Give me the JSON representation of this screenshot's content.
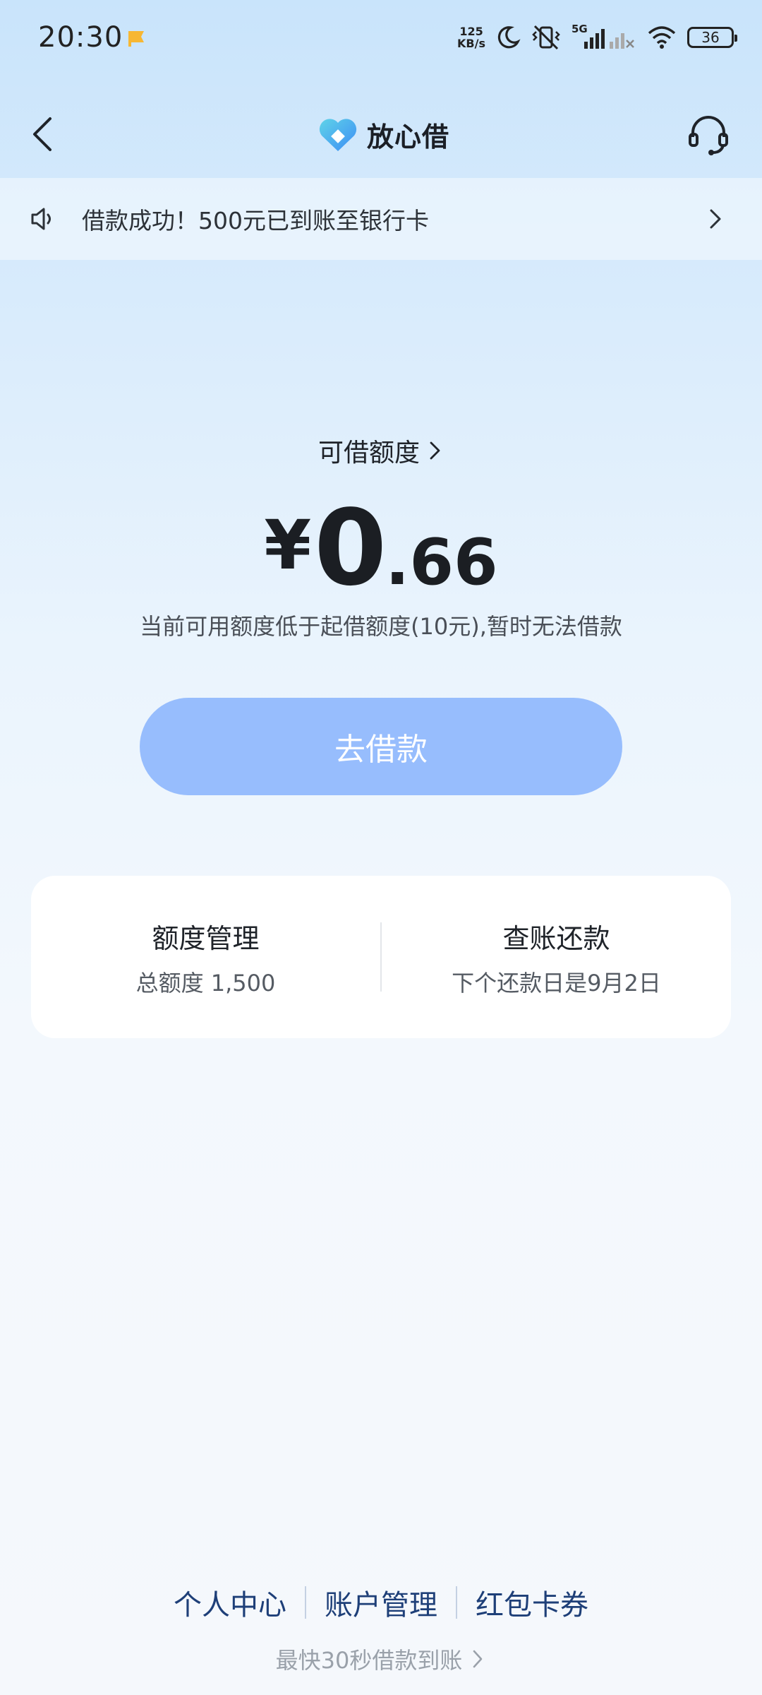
{
  "status_bar": {
    "time": "20:30",
    "net_speed_value": "125",
    "net_speed_unit": "KB/s",
    "network": "5G",
    "battery": "36",
    "icons": [
      "notification-flag-icon",
      "moon-icon",
      "vibrate-off-icon",
      "signal-icon",
      "wifi-icon",
      "battery-icon"
    ]
  },
  "nav": {
    "back_icon": "chevron-left-icon",
    "title": "放心借",
    "support_icon": "headset-icon"
  },
  "notice": {
    "icon": "speaker-icon",
    "text": "借款成功！500元已到账至银行卡",
    "arrow_icon": "chevron-right-icon"
  },
  "credit": {
    "label": "可借额度",
    "currency": "¥",
    "amount_integer": "0",
    "amount_decimal": ".66",
    "hint": "当前可用额度低于起借额度(10元),暂时无法借款",
    "button_label": "去借款"
  },
  "card": {
    "left_title": "额度管理",
    "left_sub": "总额度 1,500",
    "right_title": "查账还款",
    "right_sub": "下个还款日是9月2日"
  },
  "footer": {
    "links": [
      "个人中心",
      "账户管理",
      "红包卡券"
    ],
    "tagline": "最快30秒借款到账"
  },
  "colors": {
    "button": "#97bdfd",
    "footer_link": "#1e3f78",
    "logo_blue": "#3d8df5",
    "logo_cyan": "#5fd3e8"
  }
}
